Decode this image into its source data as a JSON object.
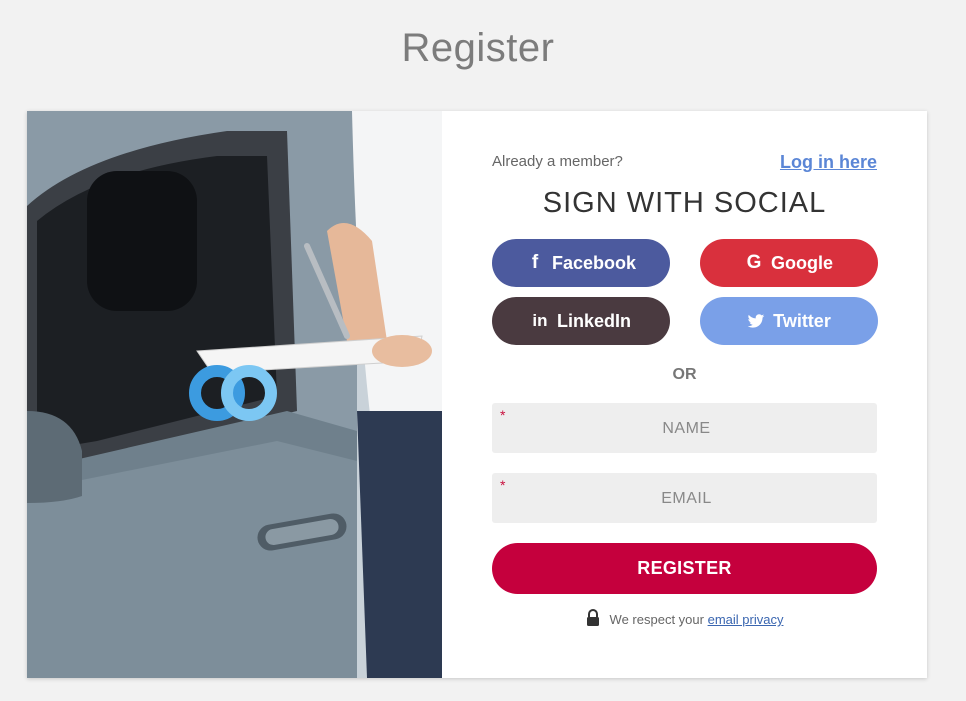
{
  "page": {
    "title": "Register"
  },
  "form": {
    "member_text": "Already a member?",
    "login_link": "Log in here",
    "social_title": "SIGN WITH SOCIAL",
    "social": {
      "facebook": "Facebook",
      "google": "Google",
      "linkedin": "LinkedIn",
      "twitter": "Twitter"
    },
    "or_text": "OR",
    "name_placeholder": "NAME",
    "email_placeholder": "EMAIL",
    "required_mark": "*",
    "register_label": "REGISTER",
    "privacy_text": "We respect your",
    "privacy_link": "email privacy"
  },
  "colors": {
    "facebook": "#4c5a9e",
    "google": "#d9303d",
    "linkedin": "#4a3a40",
    "twitter": "#7aa0e8",
    "register": "#c5003d",
    "link": "#5b86d6"
  },
  "icons": [
    "facebook-icon",
    "google-icon",
    "linkedin-icon",
    "twitter-icon",
    "lock-icon",
    "brand-logo"
  ]
}
